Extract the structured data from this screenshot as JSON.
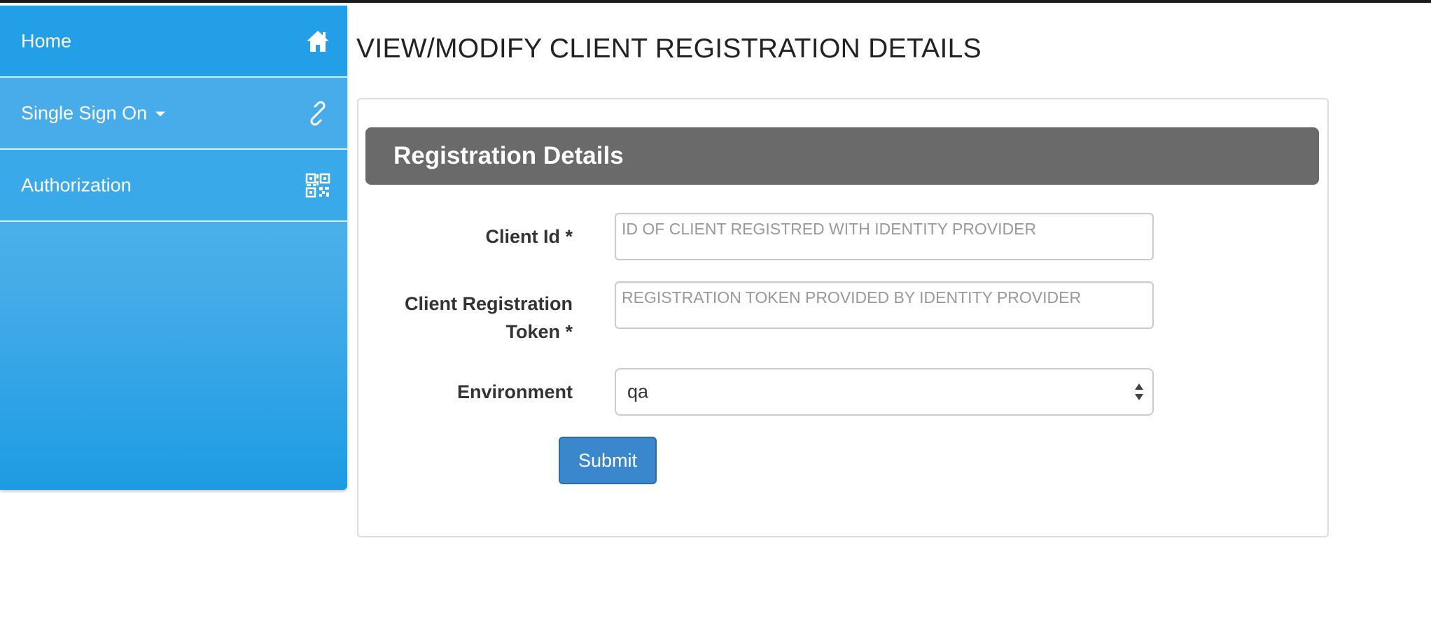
{
  "sidebar": {
    "items": [
      {
        "label": "Home",
        "icon": "home-icon"
      },
      {
        "label": "Single Sign On",
        "icon": "link-icon",
        "has_dropdown": true
      },
      {
        "label": "Authorization",
        "icon": "qr-code-icon"
      }
    ]
  },
  "page": {
    "title": "VIEW/MODIFY CLIENT REGISTRATION DETAILS"
  },
  "panel": {
    "heading": "Registration Details"
  },
  "form": {
    "client_id": {
      "label": "Client Id *",
      "value": "",
      "placeholder": "ID OF CLIENT REGISTRED WITH IDENTITY PROVIDER"
    },
    "client_token": {
      "label_line1": "Client Registration",
      "label_line2": "Token *",
      "value": "",
      "placeholder": "REGISTRATION TOKEN PROVIDED BY IDENTITY PROVIDER"
    },
    "environment": {
      "label": "Environment",
      "selected": "qa"
    },
    "submit_label": "Submit"
  },
  "colors": {
    "sidebar_blue": "#229fe6",
    "panel_heading": "#6a6a6a",
    "submit_blue": "#3a87cd"
  }
}
